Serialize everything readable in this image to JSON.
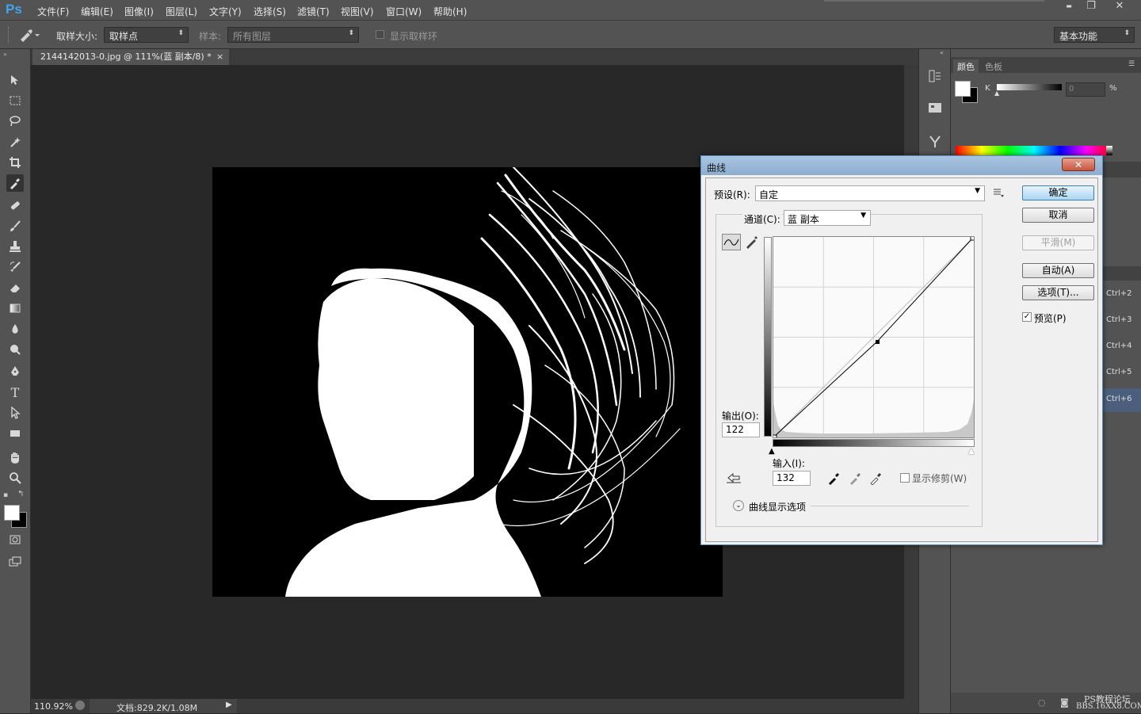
{
  "app": {
    "logo": "Ps"
  },
  "menu": [
    "文件(F)",
    "编辑(E)",
    "图像(I)",
    "图层(L)",
    "文字(Y)",
    "选择(S)",
    "滤镜(T)",
    "视图(V)",
    "窗口(W)",
    "帮助(H)"
  ],
  "window_controls": {
    "minimize": "▬",
    "restore": "❐",
    "close": "✕"
  },
  "options": {
    "sample_size_label": "取样大小:",
    "sample_size_value": "取样点",
    "sample_label": "样本:",
    "sample_value": "所有图层",
    "show_ring_label": "显示取样环",
    "workspace_value": "基本功能"
  },
  "document": {
    "tab_title": "2144142013-0.jpg @ 111%(蓝 副本/8) *",
    "tab_close": "×",
    "zoom": "110.92%",
    "doc_info": "文档:829.2K/1.08M"
  },
  "panels": {
    "color_tab": "颜色",
    "swatches_tab": "色板",
    "k_label": "K",
    "k_value": "0",
    "percent": "%",
    "layer_shortcuts": [
      "Ctrl+2",
      "Ctrl+3",
      "Ctrl+4",
      "Ctrl+5",
      "Ctrl+6"
    ]
  },
  "watermark": {
    "line1": "PS教程论坛",
    "line2": "BBS.16XX8.COM"
  },
  "curves_dialog": {
    "title": "曲线",
    "close": "✕",
    "preset_label": "预设(R):",
    "preset_value": "自定",
    "channel_label": "通道(C):",
    "channel_value": "蓝 副本",
    "output_label": "输出(O):",
    "output_value": "122",
    "input_label": "输入(I):",
    "input_value": "132",
    "show_clipping_label": "显示修剪(W)",
    "display_options_label": "曲线显示选项",
    "buttons": {
      "ok": "确定",
      "cancel": "取消",
      "smooth": "平滑(M)",
      "auto": "自动(A)",
      "options": "选项(T)...",
      "preview": "预览(P)"
    },
    "preview_checked": true,
    "curve_point": {
      "input": 132,
      "output": 122
    }
  },
  "colors": {
    "accent": "#3ea5f0",
    "dialog_border": "#5d8cc0",
    "ui_gray": "#535353"
  }
}
